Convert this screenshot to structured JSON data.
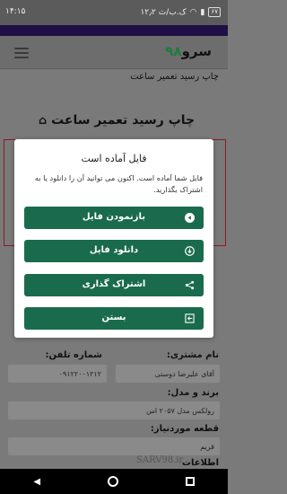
{
  "status_bar": {
    "time": "۱۴:۱۵",
    "data_speed": "۱۲٫۲ ک.ب/ث",
    "battery": "۶۷"
  },
  "app": {
    "brand_name": "سرو",
    "brand_number": "۹۸",
    "page_subtitle": "چاپ رسید تعمیر ساعت",
    "page_title": "چاپ رسید تعمیر ساعت"
  },
  "modal": {
    "title": "فایل آماده است",
    "description": "فایل شما آماده است. اکنون می توانید آن را دانلود یا به اشتراک بگذارید.",
    "buttons": [
      {
        "label": "بازنمودن فایل",
        "icon": "play-circle-icon"
      },
      {
        "label": "دانلود فایل",
        "icon": "download-icon"
      },
      {
        "label": "اشتراک گذاری",
        "icon": "share-icon"
      },
      {
        "label": "بستن",
        "icon": "exit-icon"
      }
    ]
  },
  "form": {
    "customer_name_label": "نام مشتری:",
    "customer_name_value": "آقای علیرضا دوستی",
    "phone_label": "شماره تلفن:",
    "phone_value": "۰۹۱۲۲۰۰۱۲۱۲",
    "brand_model_label": "برند و مدل:",
    "brand_model_value": "رولکس مدل ۲۰۵۷ اس",
    "part_label": "قطعه موردنیاز:",
    "part_value": "قریم",
    "extra_label": "اطلاعات"
  },
  "watermark": "SARV98.ir"
}
